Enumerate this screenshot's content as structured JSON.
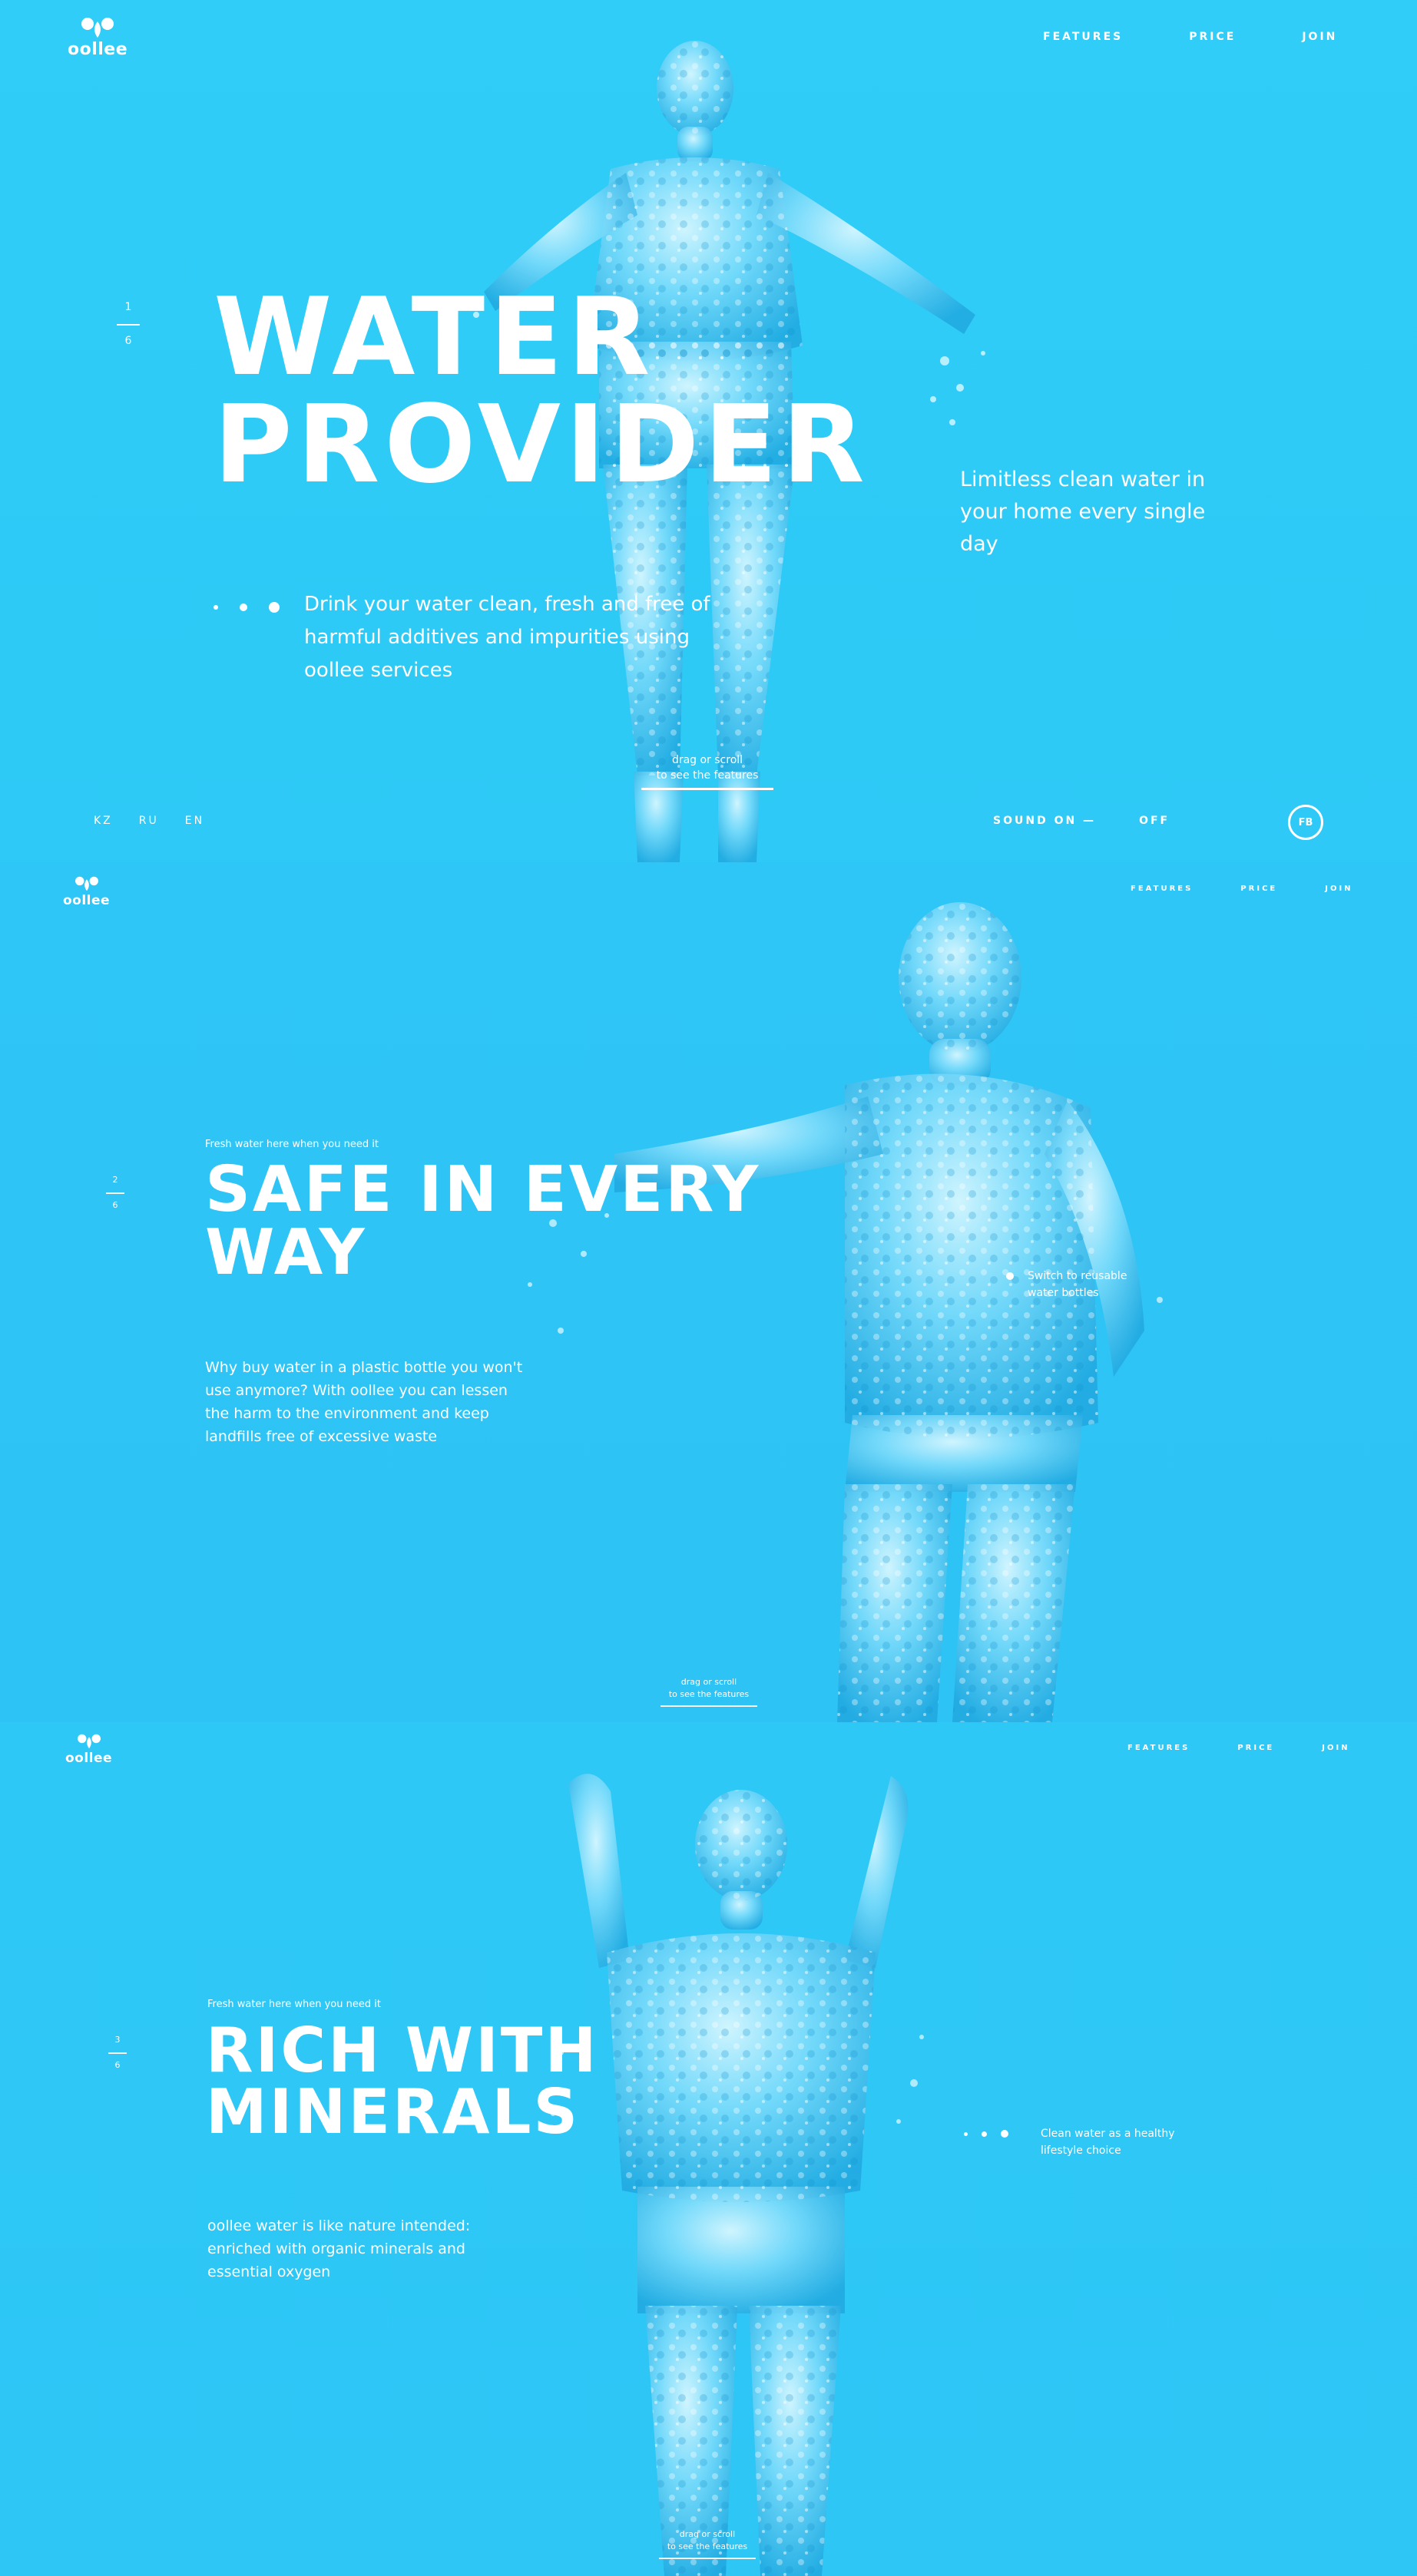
{
  "brand": {
    "logo_text": "oollee"
  },
  "nav": {
    "features": "FEATURES",
    "price": "PRICE",
    "join": "JOIN"
  },
  "colors": {
    "background": "#2ec8f6",
    "text": "#ffffff",
    "figure_light": "#bff1ff",
    "figure_dark": "#1a9fd6"
  },
  "screens": [
    {
      "counter": {
        "current": "1",
        "total": "6"
      },
      "title_line1": "WATER",
      "title_line2": "PROVIDER",
      "tagline": "Limitless clean water in your home every single day",
      "description": "Drink your water clean, fresh and free of harmful additives and impurities using oollee services",
      "drag_hint_line1": "drag or scroll",
      "drag_hint_line2": "to see the features",
      "languages": [
        "KZ",
        "RU",
        "EN"
      ],
      "sound_label": "SOUND ON —",
      "sound_off": "OFF",
      "fb_label": "FB"
    },
    {
      "counter": {
        "current": "2",
        "total": "6"
      },
      "kicker": "Fresh water here when you need it",
      "title_line1": "SAFE IN EVERY",
      "title_line2": "WAY",
      "description": "Why buy water in a plastic bottle you won't use anymore? With oollee you can lessen the harm to the environment and keep landfills free of excessive waste",
      "annotation": "Switch to reusable water bottles",
      "drag_hint_line1": "drag or scroll",
      "drag_hint_line2": "to see the features"
    },
    {
      "counter": {
        "current": "3",
        "total": "6"
      },
      "kicker": "Fresh water here when you need it",
      "title_line1": "RICH WITH",
      "title_line2": "MINERALS",
      "description": "oollee water is like nature intended: enriched with organic minerals and essential oxygen",
      "annotation": "Clean water as a healthy lifestyle choice",
      "drag_hint_line1": "drag or scroll",
      "drag_hint_line2": "to see the features"
    }
  ]
}
